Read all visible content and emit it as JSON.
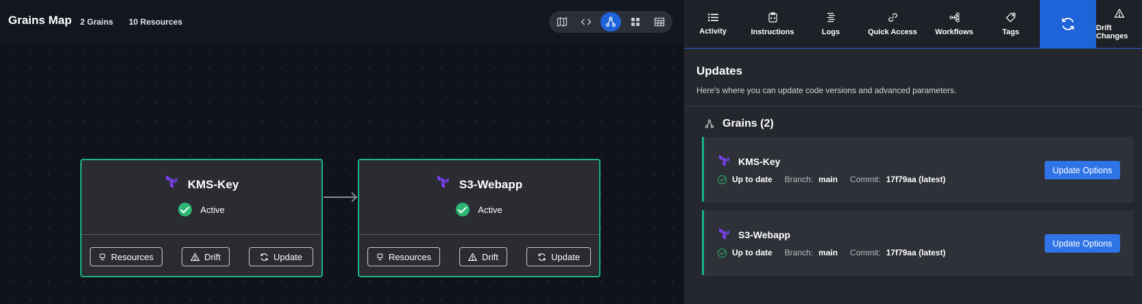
{
  "map": {
    "title": "Grains Map",
    "grains_count": "2 Grains",
    "resources_count": "10 Resources",
    "view_icons": [
      "map-icon",
      "code-icon",
      "graph-icon",
      "grid-icon",
      "table-icon"
    ],
    "active_view": "graph-icon",
    "grains": [
      {
        "name": "KMS-Key",
        "status": "Active",
        "actions": {
          "resources": "Resources",
          "drift": "Drift",
          "update": "Update"
        }
      },
      {
        "name": "S3-Webapp",
        "status": "Active",
        "actions": {
          "resources": "Resources",
          "drift": "Drift",
          "update": "Update"
        }
      }
    ]
  },
  "panel": {
    "tabs": [
      {
        "label": "Activity",
        "icon": "list-icon"
      },
      {
        "label": "Instructions",
        "icon": "instructions-icon"
      },
      {
        "label": "Logs",
        "icon": "logs-icon"
      },
      {
        "label": "Quick Access",
        "icon": "link-icon"
      },
      {
        "label": "Workflows",
        "icon": "workflows-icon"
      },
      {
        "label": "Tags",
        "icon": "tag-icon"
      },
      {
        "label": "",
        "icon": "refresh-icon",
        "active": true
      },
      {
        "label": "Drift Changes",
        "icon": "warning-icon"
      }
    ],
    "updates_title": "Updates",
    "updates_description": "Here's where you can update code versions and advanced parameters.",
    "grains_heading": "Grains (2)",
    "cards": [
      {
        "name": "KMS-Key",
        "status": "Up to date",
        "branch_label": "Branch:",
        "branch": "main",
        "commit_label": "Commit:",
        "commit": "17f79aa (latest)",
        "button": "Update Options"
      },
      {
        "name": "S3-Webapp",
        "status": "Up to date",
        "branch_label": "Branch:",
        "branch": "main",
        "commit_label": "Commit:",
        "commit": "17f79aa (latest)",
        "button": "Update Options"
      }
    ]
  },
  "colors": {
    "accent": "#1f63d9",
    "active_border": "#19b58a",
    "success": "#2bb673",
    "terraform": "#7b42f6"
  }
}
